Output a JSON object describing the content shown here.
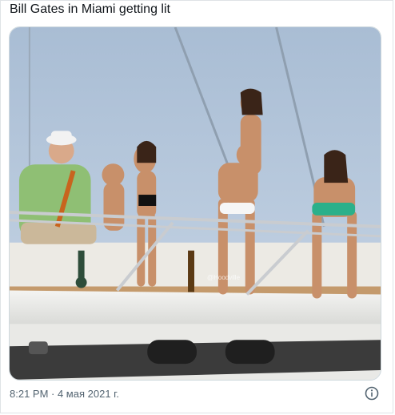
{
  "tweet": {
    "text": "Bill Gates in Miami getting lit",
    "timestamp": "8:21 PM · 4 мая 2021 г."
  },
  "media": {
    "watermark": "@Hoodville"
  },
  "icons": {
    "info": "info-circle-icon"
  },
  "colors": {
    "text": "#0f1419",
    "secondary": "#536471",
    "border": "#cfd9de"
  }
}
